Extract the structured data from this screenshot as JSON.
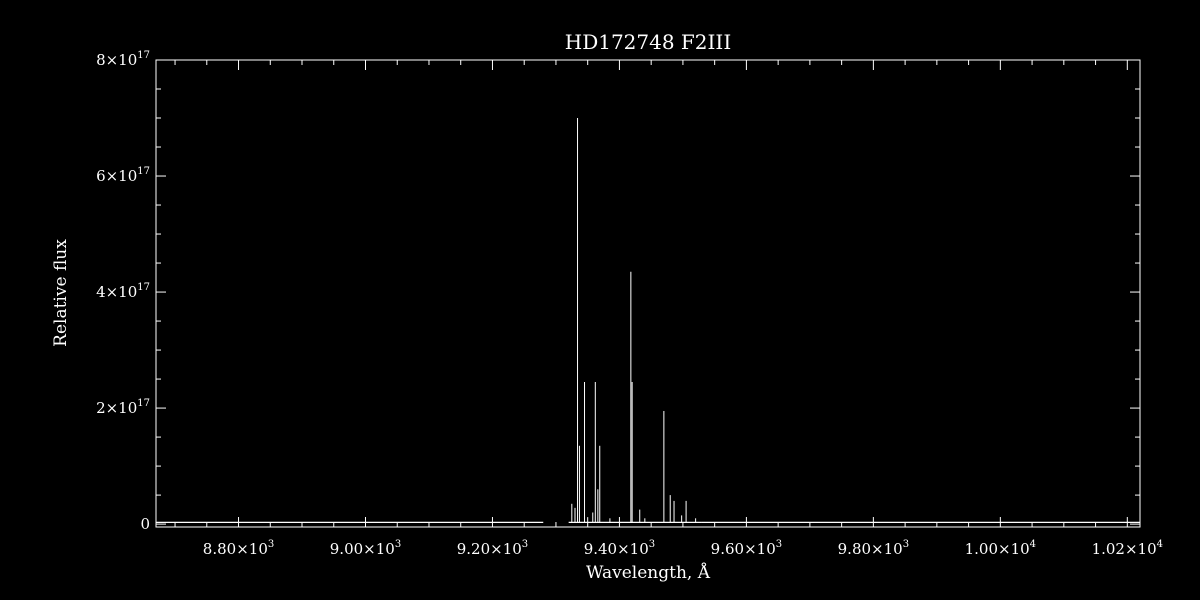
{
  "chart_data": {
    "type": "line",
    "title": "HD172748   F2III",
    "xlabel": "Wavelength, Å",
    "ylabel": "Relative flux",
    "xlim": [
      8670,
      10220
    ],
    "ylim": [
      -5000000000000000.0,
      8e+17
    ],
    "x_ticks": [
      {
        "value": 8800,
        "mantissa": "8.80",
        "exp": "3"
      },
      {
        "value": 9000,
        "mantissa": "9.00",
        "exp": "3"
      },
      {
        "value": 9200,
        "mantissa": "9.20",
        "exp": "3"
      },
      {
        "value": 9400,
        "mantissa": "9.40",
        "exp": "3"
      },
      {
        "value": 9600,
        "mantissa": "9.60",
        "exp": "3"
      },
      {
        "value": 9800,
        "mantissa": "9.80",
        "exp": "3"
      },
      {
        "value": 10000,
        "mantissa": "1.00",
        "exp": "4"
      },
      {
        "value": 10200,
        "mantissa": "1.02",
        "exp": "4"
      }
    ],
    "y_ticks": [
      {
        "value": 0,
        "mantissa": "0",
        "exp": ""
      },
      {
        "value": 2e+17,
        "mantissa": "2",
        "exp": "17"
      },
      {
        "value": 4e+17,
        "mantissa": "4",
        "exp": "17"
      },
      {
        "value": 6e+17,
        "mantissa": "6",
        "exp": "17"
      },
      {
        "value": 8e+17,
        "mantissa": "8",
        "exp": "17"
      }
    ],
    "baseline": 3000000000000000.0,
    "baseline_ranges": [
      [
        8670,
        9280
      ],
      [
        9530,
        10220
      ]
    ],
    "spikes": [
      {
        "x": 9325,
        "y": 3.5e+16
      },
      {
        "x": 9330,
        "y": 2.8e+16
      },
      {
        "x": 9334,
        "y": 7e+17
      },
      {
        "x": 9337,
        "y": 1.35e+17
      },
      {
        "x": 9345,
        "y": 2.45e+17
      },
      {
        "x": 9350,
        "y": 1.2e+16
      },
      {
        "x": 9358,
        "y": 2e+16
      },
      {
        "x": 9362,
        "y": 2.45e+17
      },
      {
        "x": 9366,
        "y": 6e+16
      },
      {
        "x": 9369,
        "y": 1.35e+17
      },
      {
        "x": 9385,
        "y": 1e+16
      },
      {
        "x": 9418,
        "y": 4.35e+17
      },
      {
        "x": 9420,
        "y": 2.45e+17
      },
      {
        "x": 9432,
        "y": 2.5e+16
      },
      {
        "x": 9440,
        "y": 1e+16
      },
      {
        "x": 9470,
        "y": 1.95e+17
      },
      {
        "x": 9480,
        "y": 5e+16
      },
      {
        "x": 9486,
        "y": 4e+16
      },
      {
        "x": 9498,
        "y": 1.5e+16
      },
      {
        "x": 9505,
        "y": 4e+16
      },
      {
        "x": 9520,
        "y": 1e+16
      }
    ],
    "legend": "none",
    "grid": false
  }
}
